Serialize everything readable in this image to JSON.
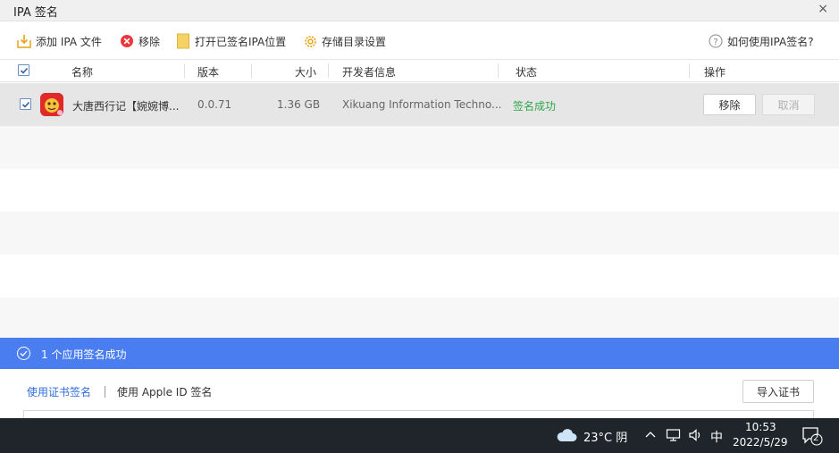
{
  "window": {
    "title": "IPA 签名",
    "close_glyph": "×"
  },
  "toolbar": {
    "add_ipa": "添加 IPA 文件",
    "remove": "移除",
    "open_signed": "打开已签名IPA位置",
    "storage_settings": "存储目录设置",
    "help": "如何使用IPA签名?"
  },
  "table": {
    "headers": {
      "name": "名称",
      "version": "版本",
      "size": "大小",
      "developer": "开发者信息",
      "status": "状态",
      "action": "操作"
    },
    "rows": [
      {
        "checked": true,
        "name": "大唐西行记【婉婉博...",
        "version": "0.0.71",
        "size": "1.36 GB",
        "developer": "Xikuang Information Techno...",
        "status": "签名成功",
        "remove_label": "移除",
        "cancel_label": "取消"
      }
    ]
  },
  "status_bar": {
    "text": "1 个应用签名成功"
  },
  "bottom": {
    "tab_cert": "使用证书签名",
    "tab_apple_id": "使用 Apple ID 签名",
    "import_cert": "导入证书"
  },
  "taskbar": {
    "weather": "23°C 阴",
    "ime": "中",
    "time": "10:53",
    "date": "2022/5/29",
    "notification_count": "2"
  },
  "colors": {
    "accent": "#4a7ef0",
    "success": "#2ea84a",
    "tab_active": "#2f6fdc",
    "taskbar": "#20252b"
  }
}
